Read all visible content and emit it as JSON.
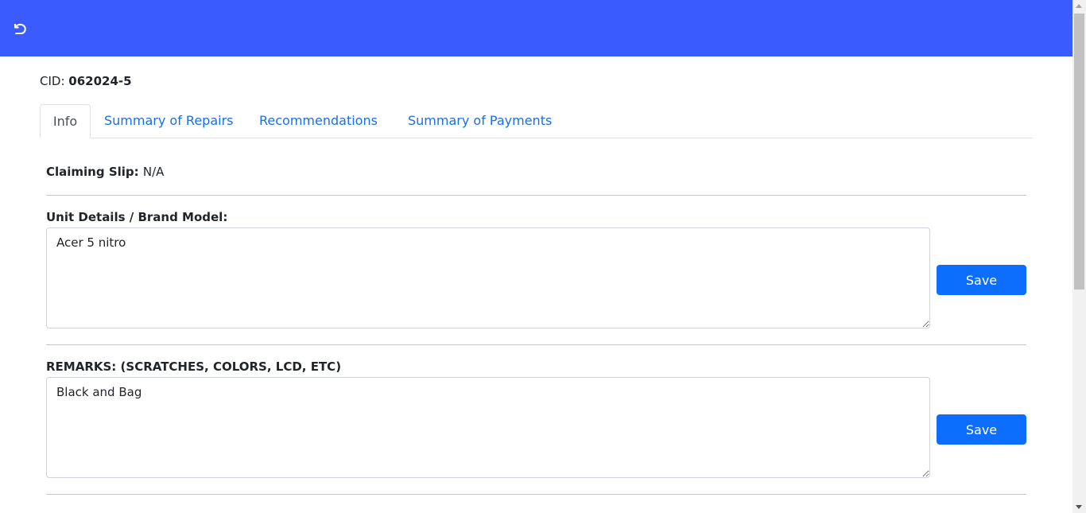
{
  "header": {
    "background_color": "#3a5cff",
    "back_icon": "undo-arrow-icon"
  },
  "cid": {
    "label": "CID:",
    "value": "062024-5"
  },
  "tabs": [
    {
      "label": "Info",
      "active": true
    },
    {
      "label": "Summary of Repairs",
      "active": false
    },
    {
      "label": "Recommendations",
      "active": false
    },
    {
      "label": "Summary of Payments",
      "active": false
    }
  ],
  "info": {
    "claiming_slip": {
      "label": "Claiming Slip:",
      "value": "N/A"
    },
    "unit_details": {
      "label": "Unit Details / Brand Model:",
      "value": "Acer 5 nitro",
      "save_label": "Save"
    },
    "remarks": {
      "label": "REMARKS: (SCRATCHES, COLORS, LCD, ETC)",
      "value": "Black and Bag",
      "save_label": "Save"
    }
  },
  "colors": {
    "accent": "#0d6efd",
    "link": "#1a6fe8"
  }
}
